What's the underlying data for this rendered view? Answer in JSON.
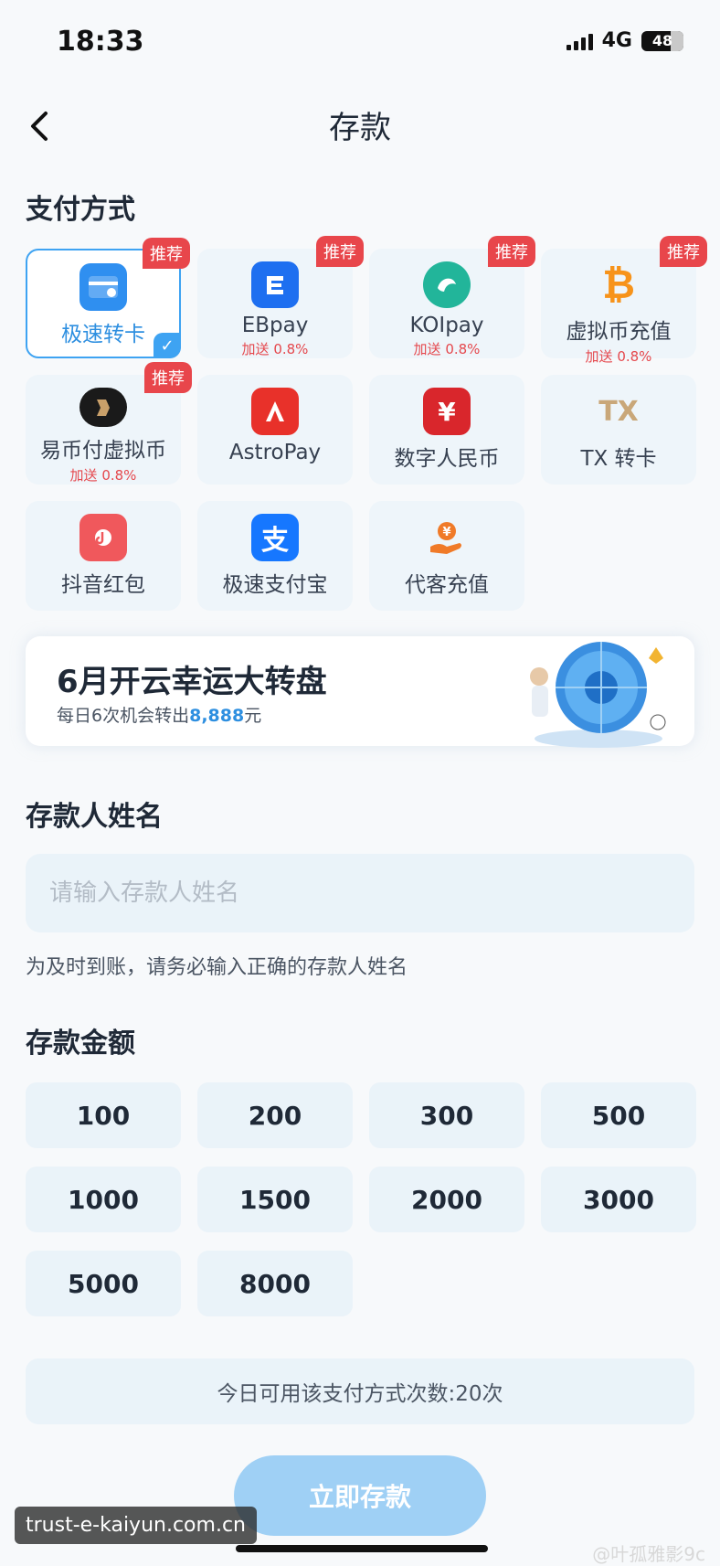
{
  "status": {
    "time": "18:33",
    "network": "4G",
    "battery": "48"
  },
  "header": {
    "title": "存款"
  },
  "payment": {
    "label": "支付方式",
    "tag": "推荐",
    "methods": [
      {
        "name": "极速转卡",
        "icon": "card-icon",
        "color": "#2f8ff0"
      },
      {
        "name": "EBpay",
        "bonus": "加送 0.8%",
        "icon": "ebpay-icon",
        "color": "#1e6ff0"
      },
      {
        "name": "KOIpay",
        "bonus": "加送 0.8%",
        "icon": "koi-icon",
        "color": "#22b59a"
      },
      {
        "name": "虚拟币充值",
        "bonus": "加送 0.8%",
        "icon": "bitcoin-icon",
        "color": "#f7931a"
      },
      {
        "name": "易币付虚拟币",
        "bonus": "加送 0.8%",
        "icon": "yibifu-icon",
        "color": "#1a1a1a"
      },
      {
        "name": "AstroPay",
        "icon": "astropay-icon",
        "color": "#e8312a"
      },
      {
        "name": "数字人民币",
        "icon": "digital-rmb-icon",
        "color": "#d9262c"
      },
      {
        "name": "TX 转卡",
        "icon": "tx-icon",
        "color": "#c9a779"
      },
      {
        "name": "抖音红包",
        "icon": "red-envelope-icon",
        "color": "#f0585c"
      },
      {
        "name": "极速支付宝",
        "icon": "alipay-icon",
        "color": "#1677ff"
      },
      {
        "name": "代客充值",
        "icon": "hand-coin-icon",
        "color": "#f07a28"
      }
    ]
  },
  "banner": {
    "title": "6月开云幸运大转盘",
    "sub_prefix": "每日6次机会转出",
    "sub_amount": "8,888",
    "sub_suffix": "元"
  },
  "depositor": {
    "label": "存款人姓名",
    "placeholder": "请输入存款人姓名",
    "hint": "为及时到账，请务必输入正确的存款人姓名"
  },
  "amount": {
    "label": "存款金额",
    "options": [
      "100",
      "200",
      "300",
      "500",
      "1000",
      "1500",
      "2000",
      "3000",
      "5000",
      "8000"
    ]
  },
  "limit_text": "今日可用该支付方式次数:20次",
  "submit_label": "立即存款",
  "watermark": {
    "left": "trust-e-kaiyun.com.cn",
    "right": "@叶孤雅影9c"
  }
}
